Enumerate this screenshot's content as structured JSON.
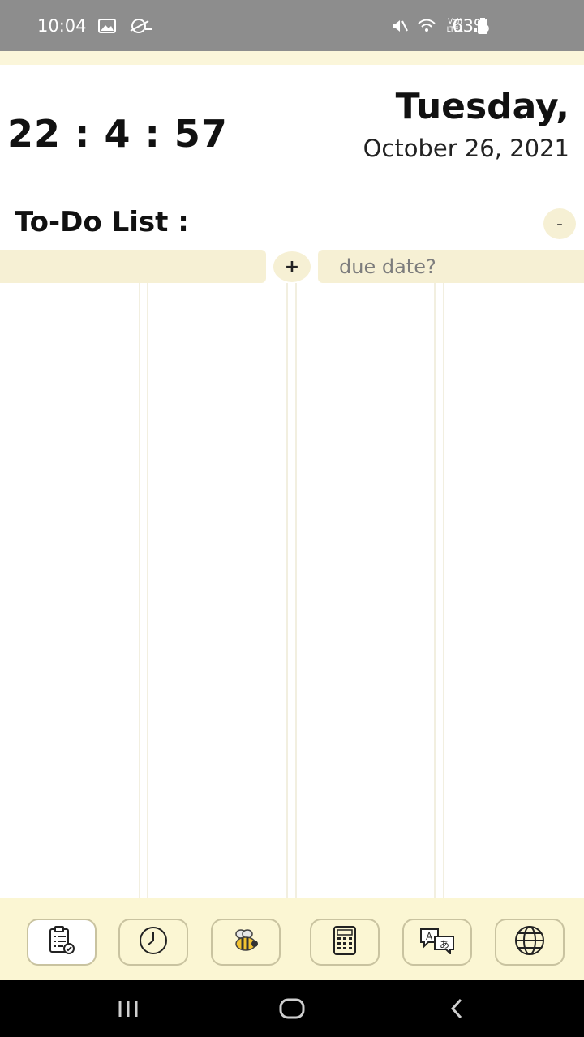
{
  "status_bar": {
    "time": "10:04",
    "network_label": "Vo)) LTE1",
    "battery": "63%"
  },
  "clock": {
    "time": "22 : 4 : 57"
  },
  "date": {
    "day": "Tuesday,",
    "full_date": "October 26, 2021"
  },
  "todo": {
    "title": "To-Do List :",
    "remove_label": "-",
    "add_label": "+",
    "task_value": "",
    "due_placeholder": "due date?"
  },
  "bottom_nav": {
    "items": [
      {
        "name": "todo-list",
        "icon": "clipboard-check-icon",
        "active": true
      },
      {
        "name": "clock",
        "icon": "clock-icon",
        "active": false
      },
      {
        "name": "bee",
        "icon": "bee-icon",
        "active": false
      },
      {
        "name": "calculator",
        "icon": "calculator-icon",
        "active": false
      },
      {
        "name": "translate",
        "icon": "translate-icon",
        "active": false
      },
      {
        "name": "globe",
        "icon": "globe-icon",
        "active": false
      }
    ]
  },
  "colors": {
    "accent_bg": "#fbf6d3",
    "status_bar": "#8d8d8d",
    "nav_border": "#c9c3a0"
  }
}
